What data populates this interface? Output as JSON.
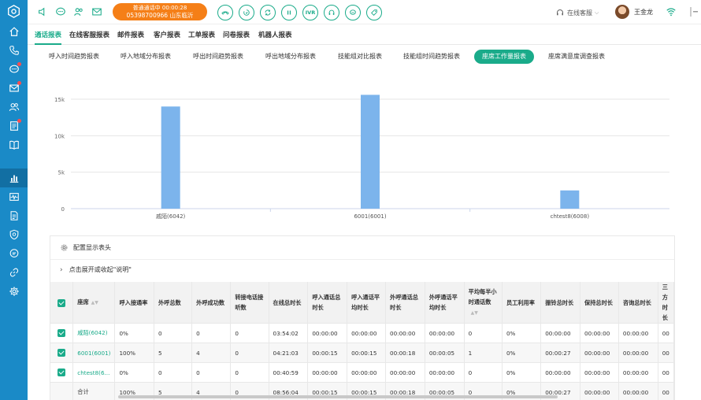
{
  "call": {
    "status": "普通通话中",
    "timer": "00:00:28",
    "number": "05398700966",
    "location": "山东临沂"
  },
  "controls": [
    {
      "name": "hangup",
      "label": ""
    },
    {
      "name": "hold",
      "label": ""
    },
    {
      "name": "transfer",
      "label": ""
    },
    {
      "name": "pause",
      "label": ""
    },
    {
      "name": "ivr",
      "label": "IVR"
    },
    {
      "name": "consult",
      "label": ""
    },
    {
      "name": "chat",
      "label": ""
    },
    {
      "name": "satisfaction",
      "label": ""
    }
  ],
  "agent_status": "在线客服",
  "user_name": "王金龙",
  "report_tabs": [
    "通话报表",
    "在线客服报表",
    "邮件报表",
    "客户报表",
    "工单报表",
    "问卷报表",
    "机器人报表"
  ],
  "sub_tabs": [
    "呼入时间趋势报表",
    "呼入地域分布报表",
    "呼出时间趋势报表",
    "呼出地域分布报表",
    "技能组对比报表",
    "技能组时间趋势报表",
    "座席工作量报表",
    "座席满意度调查报表"
  ],
  "chart_data": {
    "type": "bar",
    "categories": [
      "戚陌(6042)",
      "6001(6001)",
      "chtest8(6008)"
    ],
    "values": [
      14000,
      15600,
      2500
    ],
    "y_ticks": [
      "0",
      "5k",
      "10k",
      "15k"
    ],
    "ylim": [
      0,
      15000
    ],
    "grid": true,
    "color": "#7cb4ec"
  },
  "table": {
    "config_label": "配置显示表头",
    "expand_label": "点击展开或收起\"说明\"",
    "headers": [
      "座席",
      "呼入接通率",
      "外呼总数",
      "外呼成功数",
      "转接电话接听数",
      "在线总时长",
      "呼入通话总时长",
      "呼入通话平均时长",
      "外呼通话总时长",
      "外呼通话平均时长",
      "平均每半小时通话数",
      "员工利用率",
      "振铃总时长",
      "保持总时长",
      "咨询总时长",
      "三方时长"
    ],
    "rows": [
      [
        "戚陌(6042)",
        "0%",
        "0",
        "0",
        "0",
        "03:54:02",
        "00:00:00",
        "00:00:00",
        "00:00:00",
        "00:00:00",
        "0",
        "0%",
        "00:00:00",
        "00:00:00",
        "00:00:00",
        "00"
      ],
      [
        "6001(6001)",
        "100%",
        "5",
        "4",
        "0",
        "04:21:03",
        "00:00:15",
        "00:00:15",
        "00:00:18",
        "00:00:05",
        "1",
        "0%",
        "00:00:27",
        "00:00:00",
        "00:00:00",
        "00"
      ],
      [
        "chtest8(6...",
        "0%",
        "0",
        "0",
        "0",
        "00:40:59",
        "00:00:00",
        "00:00:00",
        "00:00:00",
        "00:00:00",
        "0",
        "0%",
        "00:00:00",
        "00:00:00",
        "00:00:00",
        "00"
      ],
      [
        "合计",
        "100%",
        "5",
        "4",
        "0",
        "08:56:04",
        "00:00:15",
        "00:00:15",
        "00:00:18",
        "00:00:05",
        "0",
        "0%",
        "00:00:27",
        "00:00:00",
        "00:00:00",
        "00"
      ]
    ]
  },
  "colors": {
    "sidebar": "#1a8ac7",
    "accent": "#1aab8a",
    "call": "#f57f17"
  }
}
